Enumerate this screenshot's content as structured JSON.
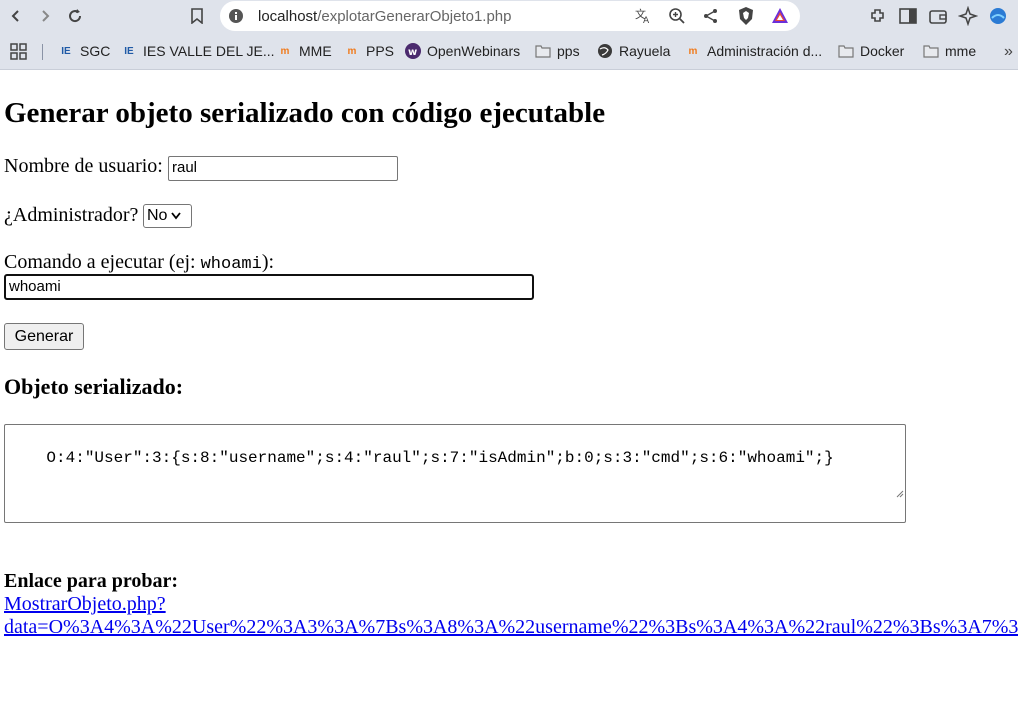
{
  "browser": {
    "url_host": "localhost",
    "url_path": "/explotarGenerarObjeto1.php"
  },
  "bookmarks": [
    {
      "label": "SGC",
      "icon": "ies-icon"
    },
    {
      "label": "IES VALLE DEL JE...",
      "icon": "ies-icon"
    },
    {
      "label": "MME",
      "icon": "moodle-icon"
    },
    {
      "label": "PPS",
      "icon": "moodle-icon"
    },
    {
      "label": "OpenWebinars",
      "icon": "openwebinars-icon"
    },
    {
      "label": "pps",
      "icon": "folder-icon"
    },
    {
      "label": "Rayuela",
      "icon": "globe-icon"
    },
    {
      "label": "Administración d...",
      "icon": "moodle-icon"
    },
    {
      "label": "Docker",
      "icon": "folder-icon"
    },
    {
      "label": "mme",
      "icon": "folder-icon"
    }
  ],
  "page": {
    "title": "Generar objeto serializado con código ejecutable",
    "username_label": "Nombre de usuario:",
    "username_value": "raul",
    "admin_label": "¿Administrador?",
    "admin_selected": "No",
    "command_label_prefix": "Comando a ejecutar (ej: ",
    "command_label_code": "whoami",
    "command_label_suffix": "):",
    "command_value": "whoami",
    "generate_button": "Generar",
    "serialized_heading": "Objeto serializado:",
    "serialized_value": "O:4:\"User\":3:{s:8:\"username\";s:4:\"raul\";s:7:\"isAdmin\";b:0;s:3:\"cmd\";s:6:\"whoami\";}",
    "test_link_label": "Enlace para probar:",
    "test_link_line1": "MostrarObjeto.php?",
    "test_link_line2": "data=O%3A4%3A%22User%22%3A3%3A%7Bs%3A8%3A%22username%22%3Bs%3A4%3A%22raul%22%3Bs%3A7%3"
  }
}
